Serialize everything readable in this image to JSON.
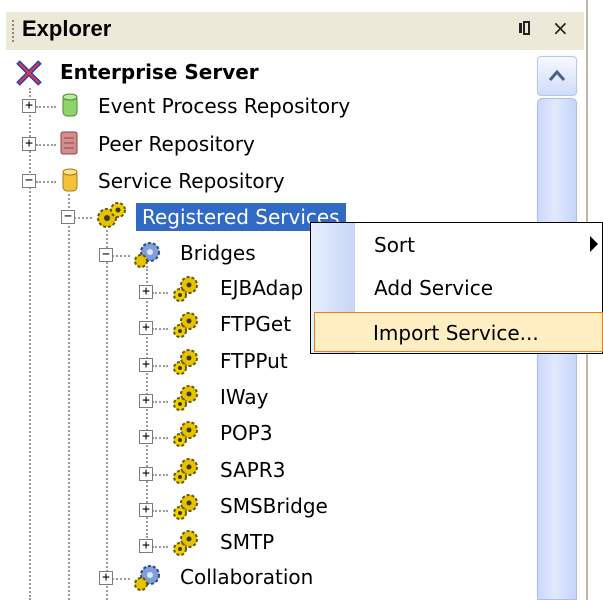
{
  "panel": {
    "title": "Explorer",
    "pin_glyph": "⁜",
    "close_glyph": "×"
  },
  "tree": {
    "root": {
      "label": "Enterprise Server",
      "icon": "enterprise-server-icon"
    },
    "repositories": [
      {
        "label": "Event Process Repository",
        "icon": "database-green-icon",
        "color": "#8fd46a"
      },
      {
        "label": "Peer Repository",
        "icon": "database-red-icon",
        "color": "#d58c8c"
      },
      {
        "label": "Service Repository",
        "icon": "database-yellow-icon",
        "color": "#f2c33a"
      }
    ],
    "registered_services": {
      "label": "Registered Services",
      "icon": "gears-icon"
    },
    "bridges": {
      "label": "Bridges",
      "icon": "gear-blue-icon"
    },
    "bridge_items": [
      {
        "label": "EJBAdap"
      },
      {
        "label": "FTPGet"
      },
      {
        "label": "FTPPut"
      },
      {
        "label": "IWay"
      },
      {
        "label": "POP3"
      },
      {
        "label": "SAPR3"
      },
      {
        "label": "SMSBridge"
      },
      {
        "label": "SMTP"
      }
    ],
    "collaboration": {
      "label": "Collaboration",
      "icon": "gear-blue-icon"
    },
    "expander_plus": "+",
    "expander_minus": "−"
  },
  "context_menu": {
    "items": [
      {
        "label": "Sort",
        "has_submenu": true
      },
      {
        "label": "Add Service",
        "has_submenu": false
      },
      {
        "label": "Import Service...",
        "has_submenu": false
      }
    ]
  },
  "colors": {
    "selection": "#316ac5",
    "menu_hover_bg": "#ffeec2",
    "menu_hover_border": "#e07f28"
  }
}
